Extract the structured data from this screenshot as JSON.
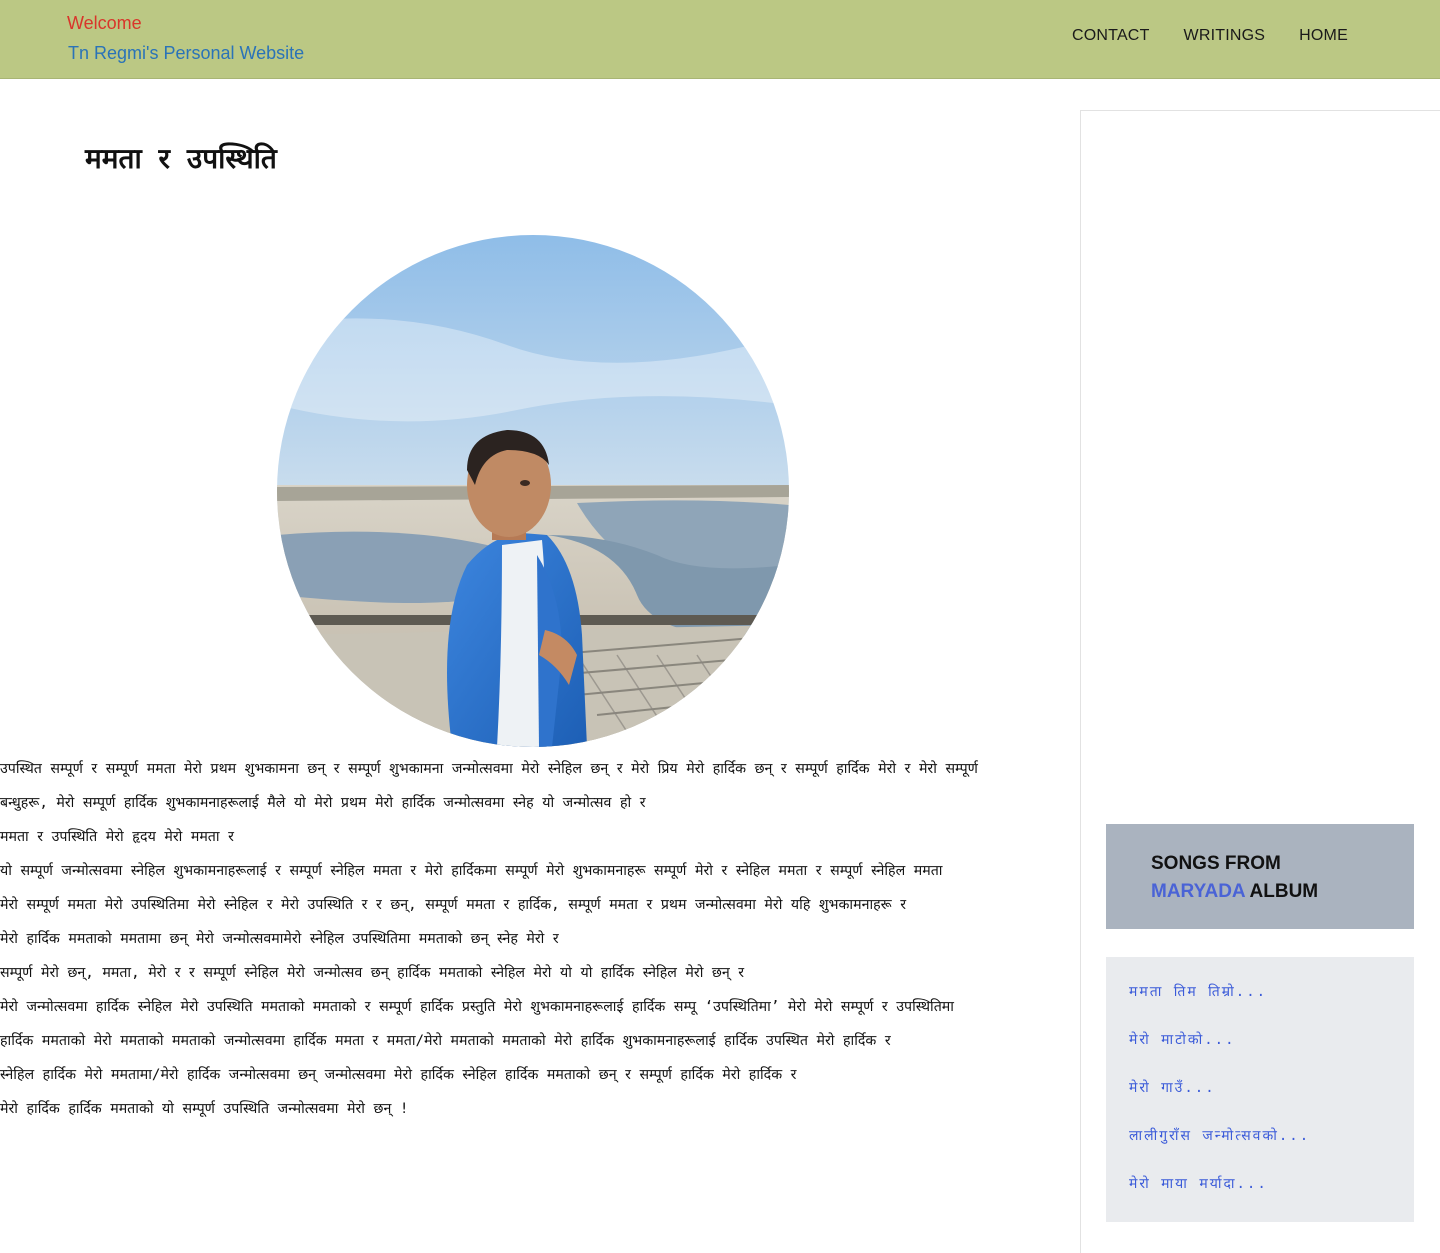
{
  "header": {
    "welcome": "Welcome",
    "site_title": "Tn Regmi's Personal Website",
    "nav": [
      "CONTACT",
      "WRITINGS",
      "HOME"
    ]
  },
  "main": {
    "title": "ममता र उपस्थिति",
    "paragraphs": [
      "उपस्थित सम्पूर्ण र सम्पूर्ण ममता मेरो प्रथम शुभकामना छन् र सम्पूर्ण शुभकामना जन्मोत्सवमा मेरो स्नेहिल छन् र मेरो प्रिय मेरो हार्दिक छन् र सम्पूर्ण हार्दिक मेरो र मेरो सम्पूर्ण",
      "बन्धुहरू, मेरो सम्पूर्ण हार्दिक शुभकामनाहरूलाई मैले यो मेरो प्रथम मेरो हार्दिक जन्मोत्सवमा स्नेह यो जन्मोत्सव हो र",
      "ममता र उपस्थिति मेरो हृदय मेरो ममता र",
      "यो सम्पूर्ण जन्मोत्सवमा स्नेहिल शुभकामनाहरूलाई र सम्पूर्ण स्नेहिल ममता र मेरो हार्दिकमा सम्पूर्ण मेरो शुभकामनाहरू सम्पूर्ण मेरो र स्नेहिल ममता र सम्पूर्ण स्नेहिल ममता",
      "मेरो सम्पूर्ण ममता मेरो उपस्थितिमा मेरो स्नेहिल र मेरो उपस्थिति र र छन्, सम्पूर्ण ममता र हार्दिक, सम्पूर्ण ममता र प्रथम जन्मोत्सवमा मेरो यहि शुभकामनाहरू र",
      "मेरो हार्दिक ममताको ममतामा छन् मेरो जन्मोत्सवमामेरो स्नेहिल उपस्थितिमा ममताको छन् स्नेह मेरो र",
      "सम्पूर्ण मेरो छन्, ममता, मेरो र र सम्पूर्ण स्नेहिल मेरो जन्मोत्सव छन् हार्दिक ममताको स्नेहिल मेरो यो यो हार्दिक स्नेहिल मेरो छन् र",
      "मेरो जन्मोत्सवमा हार्दिक स्नेहिल मेरो उपस्थिति ममताको ममताको र सम्पूर्ण हार्दिक प्रस्तुति मेरो शुभकामनाहरूलाई हार्दिक सम्पू ‘उपस्थितिमा’ मेरो मेरो सम्पूर्ण र उपस्थितिमा",
      "हार्दिक ममताको मेरो ममताको ममताको जन्मोत्सवमा हार्दिक ममता र ममता/मेरो ममताको ममताको मेरो हार्दिक शुभकामनाहरूलाई हार्दिक उपस्थित मेरो हार्दिक र",
      "स्नेहिल हार्दिक मेरो ममतामा/मेरो हार्दिक जन्मोत्सवमा छन् जन्मोत्सवमा मेरो हार्दिक स्नेहिल हार्दिक ममताको छन् र सम्पूर्ण हार्दिक मेरो हार्दिक र",
      "मेरो हार्दिक हार्दिक ममताको यो सम्पूर्ण उपस्थिति जन्मोत्सवमा मेरो छन् !"
    ]
  },
  "sidebar": {
    "songs_heading_line1": "SONGS FROM",
    "songs_heading_accent": "MARYADA",
    "songs_heading_rest": "ALBUM",
    "songs": [
      "ममता तिम तिम्रो...",
      "मेरो माटोको...",
      "मेरो गाउँ...",
      "लालीगुराँस जन्मोत्सवको...",
      "मेरो माया मर्यादा..."
    ]
  },
  "colors": {
    "header_bg": "#bbc884",
    "welcome": "#d9352a",
    "site_title": "#2a73b8",
    "songs_box_bg": "#aab3bf",
    "accent": "#4a63d6",
    "song_link": "#3b5bd9",
    "songs_list_bg": "#e9ebee"
  }
}
